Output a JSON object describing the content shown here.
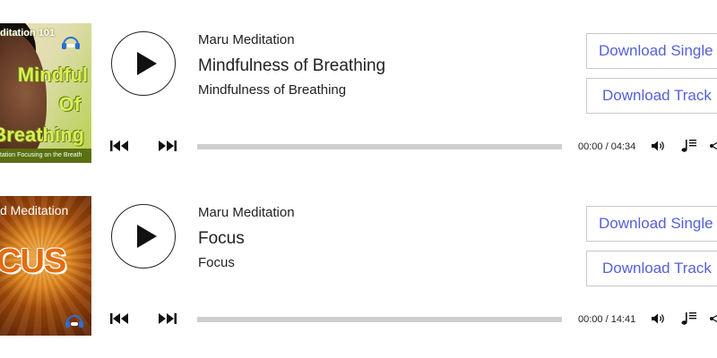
{
  "tracks": [
    {
      "cover": {
        "series_text": "ditation 101",
        "big_lines": [
          "Mindful",
          "Of",
          "Breathing"
        ],
        "strap_text": "tation Focusing on the Breath"
      },
      "artist": "Maru Meditation",
      "title": "Mindfulness of Breathing",
      "album": "Mindfulness of Breathing",
      "download_single_label": "Download Single",
      "download_track_label": "Download Track",
      "time": "00:00 / 04:34",
      "progress": 0
    },
    {
      "cover": {
        "series_text": "d Meditation",
        "big_text": "CUS"
      },
      "artist": "Maru Meditation",
      "title": "Focus",
      "album": "Focus",
      "download_single_label": "Download Single",
      "download_track_label": "Download Track",
      "time": "00:00 / 14:41",
      "progress": 0
    }
  ],
  "icons": {
    "play": "play-icon",
    "previous": "skip-previous-icon",
    "next": "skip-next-icon",
    "volume": "volume-icon",
    "playlist": "playlist-icon",
    "share": "share-icon"
  },
  "colors": {
    "download_text": "#5560d8",
    "seek_track": "#cfcfcf"
  }
}
